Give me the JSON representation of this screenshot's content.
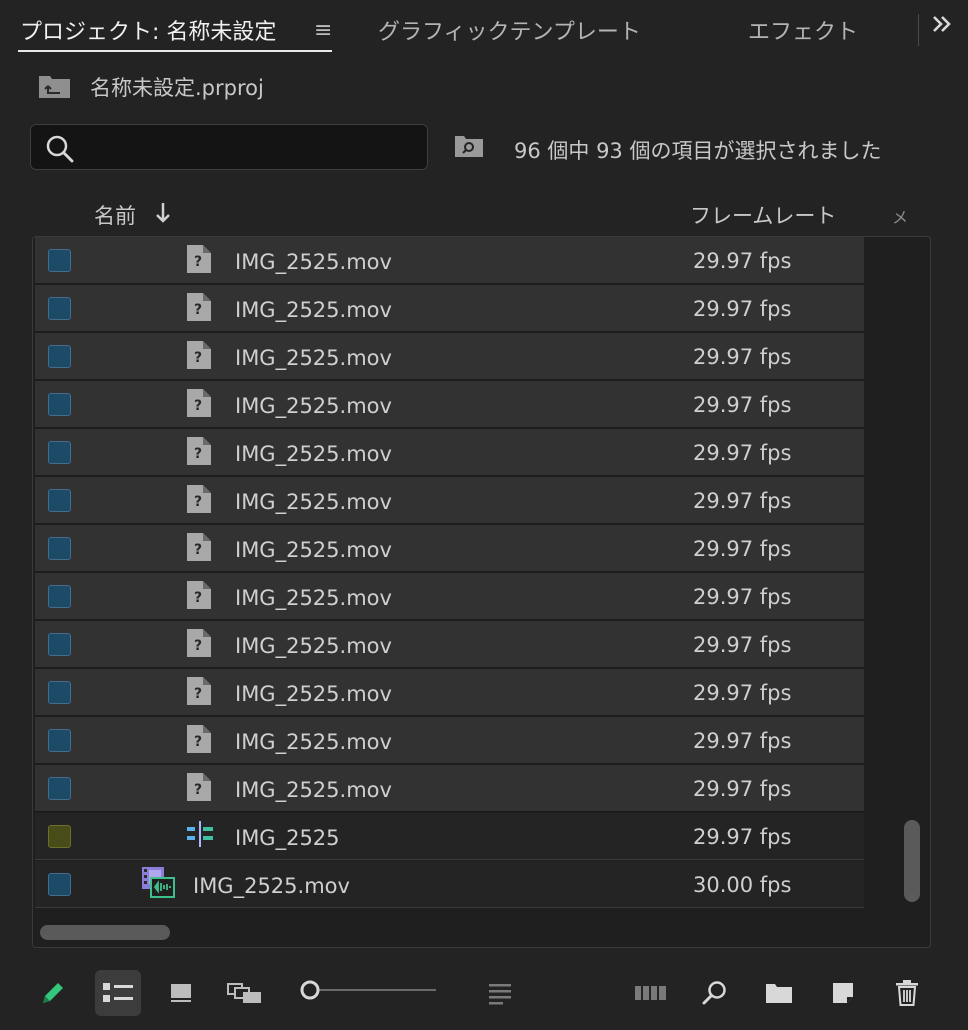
{
  "tabs": {
    "project": "プロジェクト: 名称未設定",
    "graphics": "グラフィックテンプレート",
    "effects": "エフェクト",
    "menu_glyph": "≡",
    "overflow_glyph": "»"
  },
  "project": {
    "file_name": "名称未設定.prproj",
    "icon": "project-folder-icon"
  },
  "search": {
    "value": "",
    "placeholder": "",
    "icon": "search-icon"
  },
  "selection_status": "96 個中 93 個の項目が選択されました",
  "columns": {
    "name": "名前",
    "frame_rate": "フレームレート",
    "clipped": "メ",
    "sort": "descending"
  },
  "rows": [
    {
      "name": "IMG_2525.mov",
      "fps": "29.97 fps",
      "icon": "offline-media-icon",
      "selected": true
    },
    {
      "name": "IMG_2525.mov",
      "fps": "29.97 fps",
      "icon": "offline-media-icon",
      "selected": true
    },
    {
      "name": "IMG_2525.mov",
      "fps": "29.97 fps",
      "icon": "offline-media-icon",
      "selected": true
    },
    {
      "name": "IMG_2525.mov",
      "fps": "29.97 fps",
      "icon": "offline-media-icon",
      "selected": true
    },
    {
      "name": "IMG_2525.mov",
      "fps": "29.97 fps",
      "icon": "offline-media-icon",
      "selected": true
    },
    {
      "name": "IMG_2525.mov",
      "fps": "29.97 fps",
      "icon": "offline-media-icon",
      "selected": true
    },
    {
      "name": "IMG_2525.mov",
      "fps": "29.97 fps",
      "icon": "offline-media-icon",
      "selected": true
    },
    {
      "name": "IMG_2525.mov",
      "fps": "29.97 fps",
      "icon": "offline-media-icon",
      "selected": true
    },
    {
      "name": "IMG_2525.mov",
      "fps": "29.97 fps",
      "icon": "offline-media-icon",
      "selected": true
    },
    {
      "name": "IMG_2525.mov",
      "fps": "29.97 fps",
      "icon": "offline-media-icon",
      "selected": true
    },
    {
      "name": "IMG_2525.mov",
      "fps": "29.97 fps",
      "icon": "offline-media-icon",
      "selected": true
    },
    {
      "name": "IMG_2525.mov",
      "fps": "29.97 fps",
      "icon": "offline-media-icon",
      "selected": true
    },
    {
      "name": "IMG_2525",
      "fps": "29.97 fps",
      "icon": "sequence-icon",
      "selected": false,
      "label_color": "olive"
    },
    {
      "name": "IMG_2525.mov",
      "fps": "30.00 fps",
      "icon": "video-clip-icon",
      "selected": false
    }
  ],
  "toolbar": {
    "items": [
      "pencil-icon",
      "list-view-icon",
      "icon-view-icon",
      "freeform-view-icon",
      "zoom-slider",
      "sort-icons-icon",
      "automate-to-sequence-icon",
      "find-icon",
      "new-bin-icon",
      "new-item-icon",
      "clear-icon"
    ],
    "zoom_level": 0.0
  },
  "colors": {
    "background": "#232323",
    "list_background": "#1f1f1f",
    "row_selected": "#323232",
    "checkbox_blue": "#1d4a67",
    "checkbox_olive": "#484c19",
    "pencil_green": "#34c67a"
  }
}
